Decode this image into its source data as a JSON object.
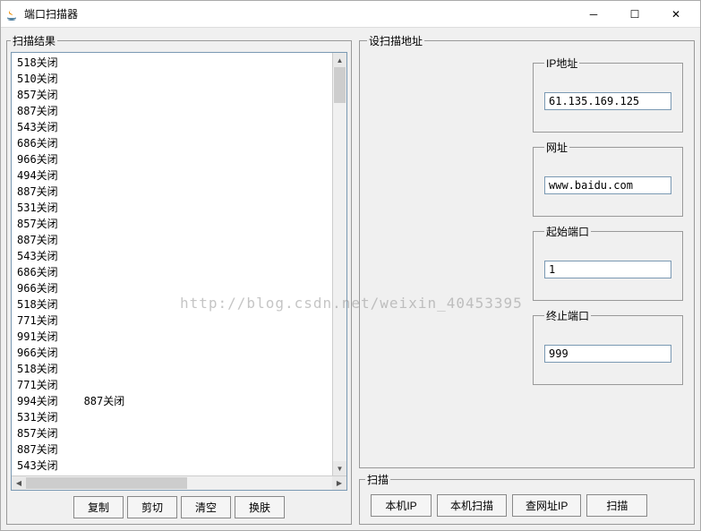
{
  "window": {
    "title": "端口扫描器"
  },
  "results": {
    "legend": "扫描结果",
    "lines": "518关闭\n510关闭\n857关闭\n887关闭\n543关闭\n686关闭\n966关闭\n494关闭\n887关闭\n531关闭\n857关闭\n887关闭\n543关闭\n686关闭\n966关闭\n518关闭\n771关闭\n991关闭\n966关闭\n518关闭\n771关闭\n994关闭    887关闭\n531关闭\n857关闭\n887关闭\n543关闭",
    "buttons": {
      "copy": "复制",
      "cut": "剪切",
      "clear": "清空",
      "skin": "换肤"
    }
  },
  "settings": {
    "legend": "设扫描地址",
    "ip": {
      "legend": "IP地址",
      "value": "61.135.169.125"
    },
    "url": {
      "legend": "网址",
      "value": "www.baidu.com"
    },
    "startPort": {
      "legend": "起始端口",
      "value": "1"
    },
    "endPort": {
      "legend": "终止端口",
      "value": "999"
    }
  },
  "scan": {
    "legend": "扫描",
    "buttons": {
      "localIp": "本机IP",
      "localScan": "本机扫描",
      "lookupUrl": "查网址IP",
      "scan": "扫描"
    }
  },
  "watermark": "http://blog.csdn.net/weixin_40453395"
}
